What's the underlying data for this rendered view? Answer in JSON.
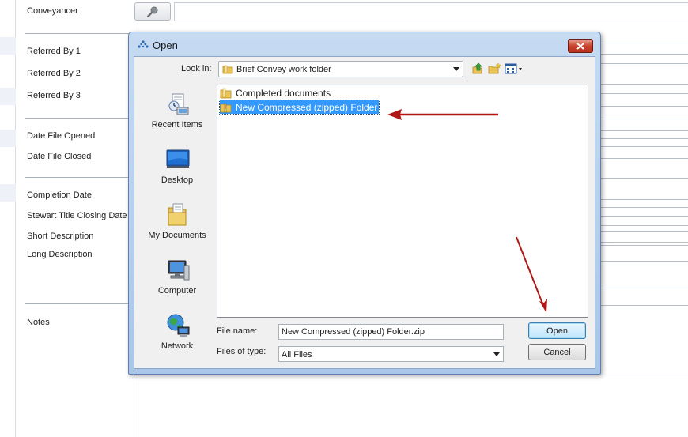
{
  "background_form": {
    "labels": [
      "Conveyancer",
      "Referred By 1",
      "Referred By 2",
      "Referred By 3",
      "Date File Opened",
      "Date File Closed",
      "Completion Date",
      "Stewart Title Closing Date",
      "Short Description",
      "Long Description",
      "Notes"
    ],
    "search_button_icon": "magnifier-icon"
  },
  "dialog": {
    "title": "Open",
    "look_in_label": "Look in:",
    "look_in_value": "Brief Convey work folder",
    "toolbar_icons": [
      "up-folder-icon",
      "new-folder-icon",
      "view-menu-icon"
    ],
    "places": [
      {
        "label": "Recent Items",
        "icon": "recent-items-icon"
      },
      {
        "label": "Desktop",
        "icon": "desktop-icon"
      },
      {
        "label": "My Documents",
        "icon": "my-documents-icon"
      },
      {
        "label": "Computer",
        "icon": "computer-icon"
      },
      {
        "label": "Network",
        "icon": "network-icon"
      }
    ],
    "files": [
      {
        "name": "Completed documents",
        "icon": "folder-icon",
        "selected": false
      },
      {
        "name": "New Compressed (zipped) Folder",
        "icon": "zip-folder-icon",
        "selected": true
      }
    ],
    "file_name_label": "File name:",
    "file_name_value": "New Compressed (zipped) Folder.zip",
    "files_of_type_label": "Files of type:",
    "files_of_type_value": "All Files",
    "open_button": "Open",
    "cancel_button": "Cancel"
  },
  "colors": {
    "selection": "#3399ff",
    "annotation_arrow": "#b01818",
    "close_button": "#c9452f",
    "titlebar": "#c6dbf2"
  }
}
